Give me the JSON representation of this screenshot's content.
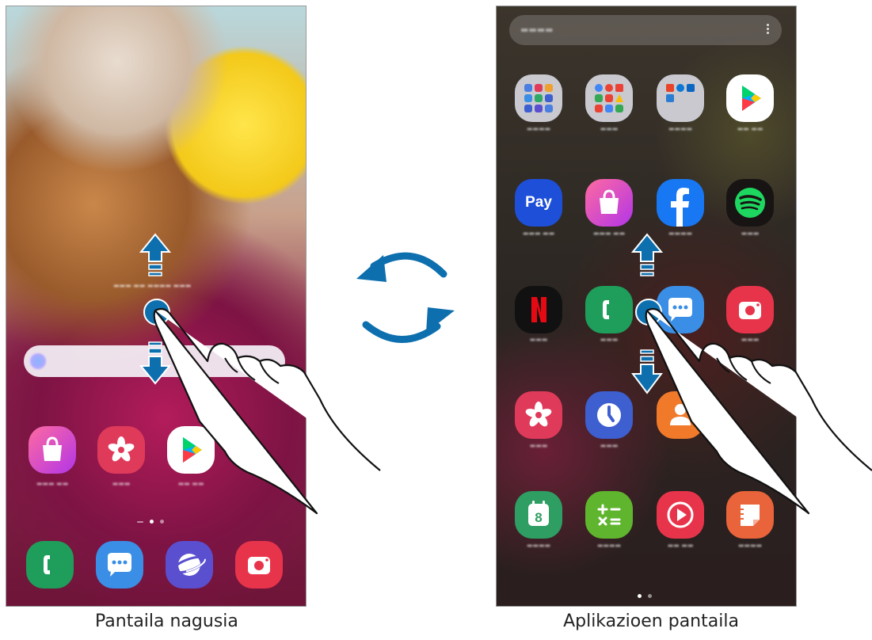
{
  "captions": {
    "home": "Pantaila nagusia",
    "apps": "Aplikazioen pantaila"
  },
  "colors": {
    "arrow": "#0d6fae",
    "gesture_dot": "#0d6fae"
  },
  "icons": {
    "rotate": "rotate-arrows-icon",
    "swipe_up": "arrow-up-icon",
    "swipe_down": "arrow-down-icon",
    "finger": "hand-pointer-icon"
  },
  "home_screen": {
    "apps": [
      {
        "icon": "galaxy-store-icon",
        "color": "#e8476a"
      },
      {
        "icon": "gallery-icon",
        "color": "#e03a5a"
      },
      {
        "icon": "play-store-icon",
        "color": "#ffffff"
      }
    ],
    "dock": [
      {
        "icon": "phone-icon",
        "color": "#1e9e5a"
      },
      {
        "icon": "messages-icon",
        "color": "#3a8ee6"
      },
      {
        "icon": "internet-icon",
        "color": "#5a4fcf"
      },
      {
        "icon": "camera-icon",
        "color": "#e8344a"
      }
    ]
  },
  "apps_screen": {
    "apps": [
      {
        "icon": "samsung-folder-icon",
        "color": "#c9c9cf"
      },
      {
        "icon": "google-folder-icon",
        "color": "#c9c9cf"
      },
      {
        "icon": "microsoft-folder-icon",
        "color": "#c9c9cf"
      },
      {
        "icon": "play-store-icon",
        "color": "#ffffff"
      },
      {
        "icon": "samsung-pay-icon",
        "color": "#1d4fd8"
      },
      {
        "icon": "galaxy-store-icon",
        "color": "#e8476a"
      },
      {
        "icon": "facebook-icon",
        "color": "#1877f2"
      },
      {
        "icon": "spotify-icon",
        "color": "#191414"
      },
      {
        "icon": "netflix-icon",
        "color": "#111111"
      },
      {
        "icon": "phone-icon",
        "color": "#1e9e5a"
      },
      {
        "icon": "messages-icon",
        "color": "#3a8ee6"
      },
      {
        "icon": "camera-icon",
        "color": "#e8344a"
      },
      {
        "icon": "gallery-icon",
        "color": "#e03a5a"
      },
      {
        "icon": "clock-icon",
        "color": "#3d5fd0"
      },
      {
        "icon": "contacts-icon",
        "color": "#f07a2a"
      },
      {
        "icon": "calendar-icon",
        "color": "#2e9e62"
      },
      {
        "icon": "calculator-icon",
        "color": "#5fb52e"
      },
      {
        "icon": "video-player-icon",
        "color": "#e8344a"
      },
      {
        "icon": "notes-icon",
        "color": "#e9643a"
      }
    ],
    "labels": {
      "pay": "Pay",
      "calendar": "8"
    }
  }
}
